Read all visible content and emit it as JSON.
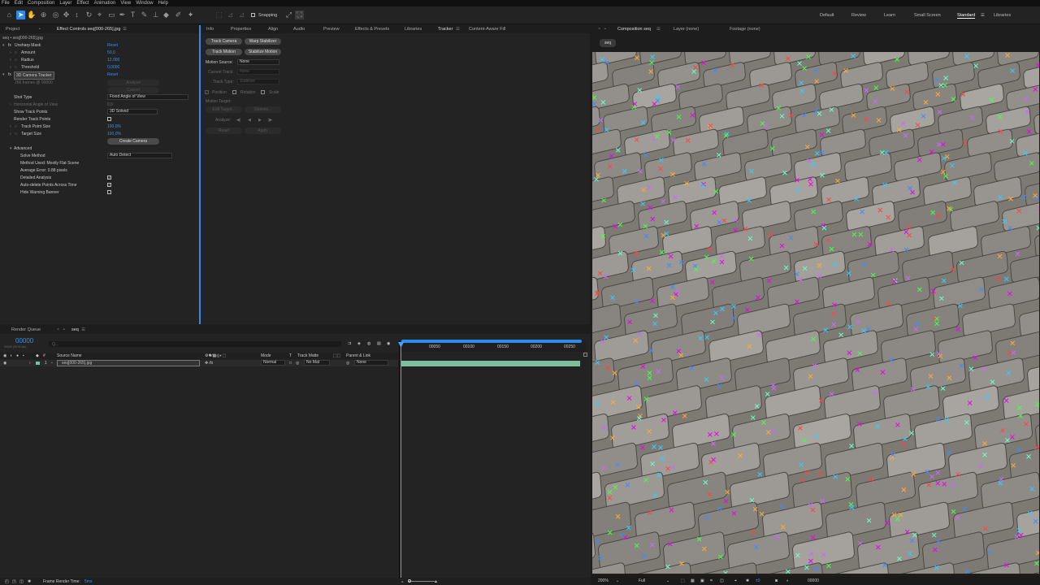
{
  "menu": [
    "File",
    "Edit",
    "Composition",
    "Layer",
    "Effect",
    "Animation",
    "View",
    "Window",
    "Help"
  ],
  "toolbar": {
    "snapping": "Snapping"
  },
  "workspaces": [
    "Default",
    "Review",
    "Learn",
    "Small Screen",
    "Standard",
    "Libraries"
  ],
  "project": {
    "tab": "Project",
    "effect_tab": "Effect Controls seq[000-265].jpg",
    "path": "seq • seq[000-265].jpg"
  },
  "effects": {
    "unsharp": {
      "name": "Unsharp Mask",
      "reset": "Reset",
      "amount_label": "Amount",
      "amount": "50,0",
      "radius_label": "Radius",
      "radius": "12,000",
      "threshold_label": "Threshold",
      "threshold": "0,0000"
    },
    "tracker3d": {
      "name": "3D Camera Tracker",
      "reset": "Reset",
      "frames": "266 frames @ 00000",
      "analyze": "Analyze",
      "cancel": "Cancel",
      "shot_type_label": "Shot Type",
      "shot_type": "Fixed Angle of View",
      "hfov_label": "Horizontal Angle of View",
      "hfov": "0,0",
      "show_points_label": "Show Track Points",
      "show_points": "3D Solved",
      "render_points_label": "Render Track Points",
      "point_size_label": "Track Point Size",
      "point_size": "100,0%",
      "target_size_label": "Target Size",
      "target_size": "100,0%",
      "create_camera": "Create Camera",
      "advanced_label": "Advanced",
      "solve_method_label": "Solve Method",
      "solve_method": "Auto Detect",
      "method_used": "Method Used: Mostly Flat Scene",
      "avg_error": "Average Error: 0.88 pixels",
      "detailed_label": "Detailed Analysis",
      "autodelete_label": "Auto-delete Points Across Time",
      "hide_warning_label": "Hide Warning Banner"
    }
  },
  "mid_tabs": [
    "Info",
    "Properties",
    "Align",
    "Audio",
    "Preview",
    "Effects & Presets",
    "Libraries",
    "Tracker",
    "Content-Aware Fill"
  ],
  "tracker": {
    "track_camera": "Track Camera",
    "warp_stabilizer": "Warp Stabilizer",
    "track_motion": "Track Motion",
    "stabilize_motion": "Stabilize Motion",
    "motion_source_label": "Motion Source:",
    "motion_source": "None",
    "current_track_label": "Current Track:",
    "current_track": "None",
    "track_type_label": "Track Type:",
    "track_type": "Stabilize",
    "position": "Position",
    "rotation": "Rotation",
    "scale": "Scale",
    "motion_target": "Motion Target:",
    "edit_target": "Edit Target...",
    "options": "Options...",
    "analyze": "Analyze:",
    "reset": "Reset",
    "apply": "Apply"
  },
  "comp": {
    "tab": "Composition seq",
    "layer_tab": "Layer (none)",
    "footage_tab": "Footage (none)",
    "sub_tab": "seq",
    "zoom": "200%",
    "res": "Full",
    "time": "00000"
  },
  "timeline": {
    "render_queue": "Render Queue",
    "comp_tab": "seq",
    "timecode": "00000",
    "fps": "00000 (25.00 fps)",
    "search_placeholder": "Q...",
    "columns": {
      "source": "Source Name",
      "mode": "Mode",
      "t": "T",
      "matte": "Track Matte",
      "parent": "Parent & Link"
    },
    "layer": {
      "num": "1",
      "name": "seq[000-265].jpg",
      "mode": "Normal",
      "matte": "No Mat",
      "parent": "None"
    },
    "ruler": [
      "00050",
      "00100",
      "00150",
      "00200",
      "00250"
    ],
    "frame_render_label": "Frame Render Time:",
    "frame_render": "5ms"
  },
  "colors": {
    "accent": "#2d8ceb",
    "layer_bar": "#7dbea0",
    "playhead": "#4aa3ff"
  }
}
